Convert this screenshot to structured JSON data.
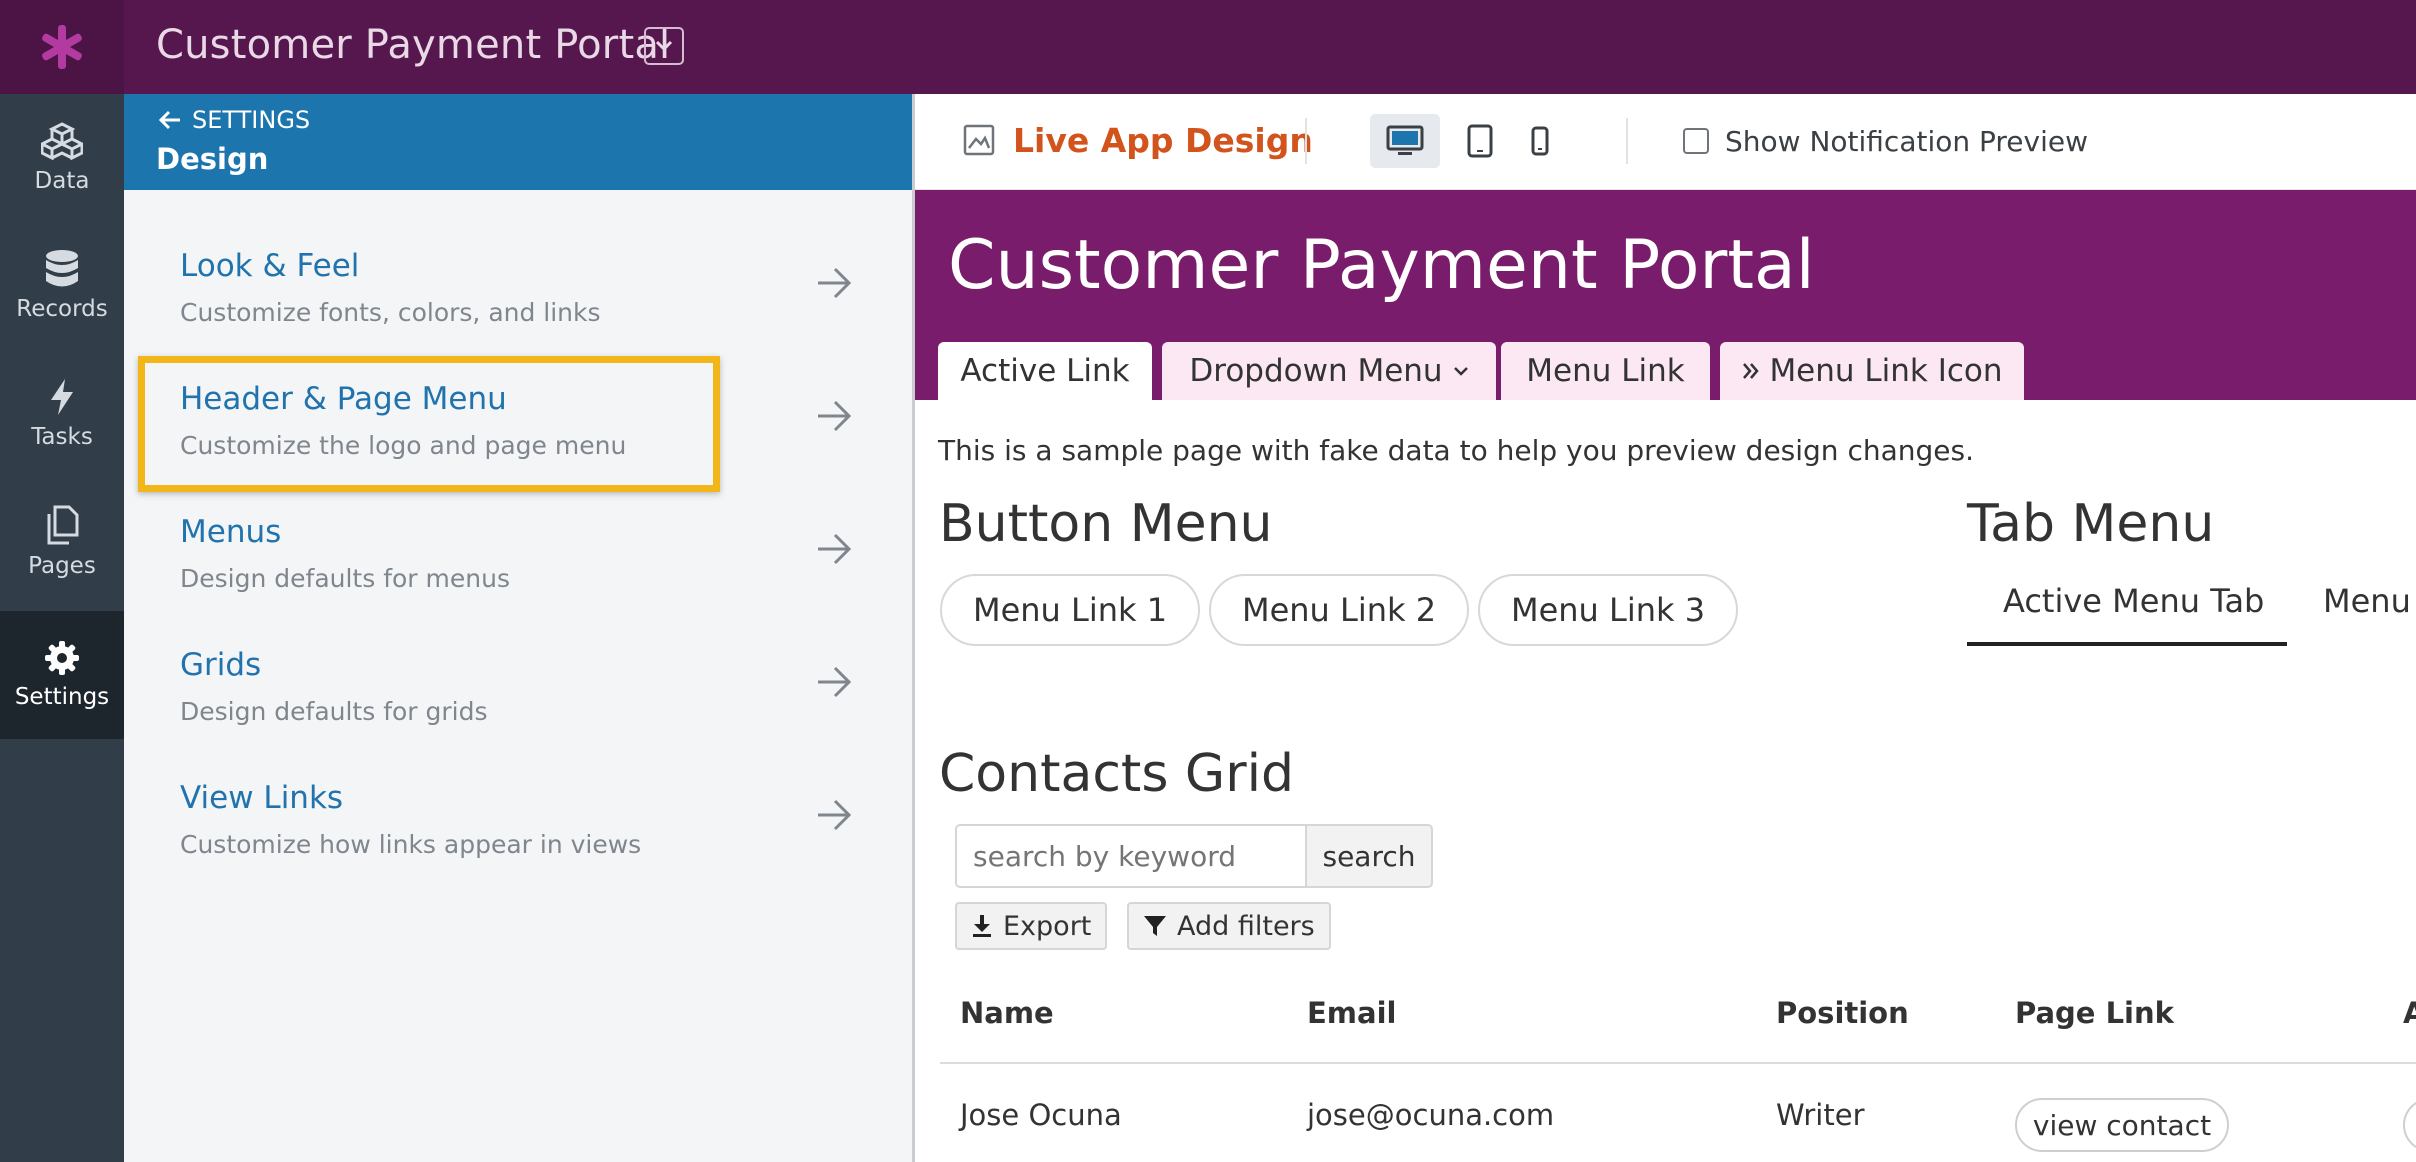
{
  "topbar": {
    "app_title": "Customer Payment Portal"
  },
  "leftnav": {
    "items": [
      {
        "label": "Data",
        "icon": "cubes-icon"
      },
      {
        "label": "Records",
        "icon": "database-icon"
      },
      {
        "label": "Tasks",
        "icon": "bolt-icon"
      },
      {
        "label": "Pages",
        "icon": "pages-icon"
      },
      {
        "label": "Settings",
        "icon": "gear-icon",
        "active": true
      }
    ]
  },
  "settings": {
    "back_label": "SETTINGS",
    "title": "Design",
    "items": [
      {
        "title": "Look & Feel",
        "desc": "Customize fonts, colors, and links"
      },
      {
        "title": "Header & Page Menu",
        "desc": "Customize the logo and page menu",
        "highlighted": true
      },
      {
        "title": "Menus",
        "desc": "Design defaults for menus"
      },
      {
        "title": "Grids",
        "desc": "Design defaults for grids"
      },
      {
        "title": "View Links",
        "desc": "Customize how links appear in views"
      }
    ]
  },
  "toolbar": {
    "title": "Live App Design",
    "devices": [
      "desktop",
      "tablet",
      "mobile"
    ],
    "active_device": "desktop",
    "notification_label": "Show Notification Preview",
    "notification_checked": false
  },
  "preview": {
    "header_title": "Customer Payment Portal",
    "tabs": [
      {
        "label": "Active Link",
        "active": true
      },
      {
        "label": "Dropdown Menu",
        "has_chevron": true
      },
      {
        "label": "Menu Link"
      },
      {
        "label": "Menu Link Icon",
        "icon": "double-chevron-right-icon"
      }
    ],
    "sample_text": "This is a sample page with fake data to help you preview design changes.",
    "button_menu": {
      "title": "Button Menu",
      "links": [
        "Menu Link 1",
        "Menu Link 2",
        "Menu Link 3"
      ]
    },
    "tab_menu": {
      "title": "Tab Menu",
      "tabs": [
        "Active Menu Tab",
        "Menu"
      ]
    },
    "contacts_grid": {
      "title": "Contacts Grid",
      "search_placeholder": "search by keyword",
      "search_button": "search",
      "export_label": "Export",
      "filters_label": "Add filters",
      "columns": [
        "Name",
        "Email",
        "Position",
        "Page Link",
        "A"
      ],
      "rows": [
        {
          "name": "Jose Ocuna",
          "email": "jose@ocuna.com",
          "position": "Writer",
          "link": "view contact"
        }
      ]
    }
  },
  "colors": {
    "topbar": "#55174d",
    "leftnav": "#313d48",
    "settings_header": "#1d75ae",
    "link_blue": "#2073ad",
    "live_orange": "#d2541c",
    "app_header": "#7a1c6c",
    "highlight": "#f3b619"
  }
}
